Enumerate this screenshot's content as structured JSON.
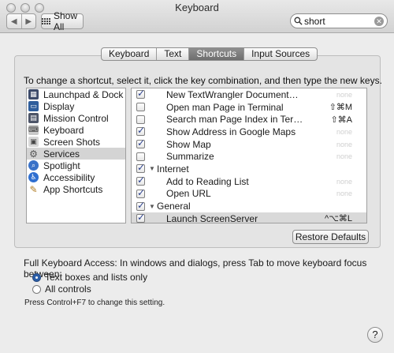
{
  "window": {
    "title": "Keyboard"
  },
  "toolbar": {
    "back_icon": "◀",
    "forward_icon": "▶",
    "show_all_label": "Show All",
    "search_value": "short"
  },
  "tabs": [
    {
      "label": "Keyboard",
      "active": false
    },
    {
      "label": "Text",
      "active": false
    },
    {
      "label": "Shortcuts",
      "active": true
    },
    {
      "label": "Input Sources",
      "active": false
    }
  ],
  "instruction": "To change a shortcut, select it, click the key combination, and then type the new keys.",
  "categories": [
    {
      "label": "Launchpad & Dock",
      "icon": "launchpad-icon",
      "selected": false
    },
    {
      "label": "Display",
      "icon": "display-icon",
      "selected": false
    },
    {
      "label": "Mission Control",
      "icon": "mission-control-icon",
      "selected": false
    },
    {
      "label": "Keyboard",
      "icon": "keyboard-icon",
      "selected": false
    },
    {
      "label": "Screen Shots",
      "icon": "screenshot-icon",
      "selected": false
    },
    {
      "label": "Services",
      "icon": "gear-icon",
      "selected": true
    },
    {
      "label": "Spotlight",
      "icon": "spotlight-icon",
      "selected": false
    },
    {
      "label": "Accessibility",
      "icon": "accessibility-icon",
      "selected": false
    },
    {
      "label": "App Shortcuts",
      "icon": "app-shortcuts-icon",
      "selected": false
    }
  ],
  "shortcuts": [
    {
      "type": "item",
      "checked": true,
      "name": "New TextWrangler Document…",
      "key": "none",
      "none": true
    },
    {
      "type": "item",
      "checked": false,
      "name": "Open man Page in Terminal",
      "key": "⇧⌘M",
      "none": false
    },
    {
      "type": "item",
      "checked": false,
      "name": "Search man Page Index in Ter…",
      "key": "⇧⌘A",
      "none": false
    },
    {
      "type": "item",
      "checked": true,
      "name": "Show Address in Google Maps",
      "key": "none",
      "none": true
    },
    {
      "type": "item",
      "checked": true,
      "name": "Show Map",
      "key": "none",
      "none": true
    },
    {
      "type": "item",
      "checked": false,
      "name": "Summarize",
      "key": "none",
      "none": true
    },
    {
      "type": "group",
      "checked": true,
      "name": "Internet"
    },
    {
      "type": "item",
      "checked": true,
      "name": "Add to Reading List",
      "key": "none",
      "none": true
    },
    {
      "type": "item",
      "checked": true,
      "name": "Open URL",
      "key": "none",
      "none": true
    },
    {
      "type": "group",
      "checked": true,
      "name": "General"
    },
    {
      "type": "item",
      "checked": true,
      "name": "Launch ScreenServer",
      "key": "^⌥⌘L",
      "none": false,
      "highlighted": true
    }
  ],
  "restore_label": "Restore Defaults",
  "full_keyboard_access": {
    "label": "Full Keyboard Access: In windows and dialogs, press Tab to move keyboard focus between:",
    "options": [
      {
        "label": "Text boxes and lists only",
        "selected": true
      },
      {
        "label": "All controls",
        "selected": false
      }
    ],
    "hint": "Press Control+F7 to change this setting."
  },
  "help_label": "?"
}
